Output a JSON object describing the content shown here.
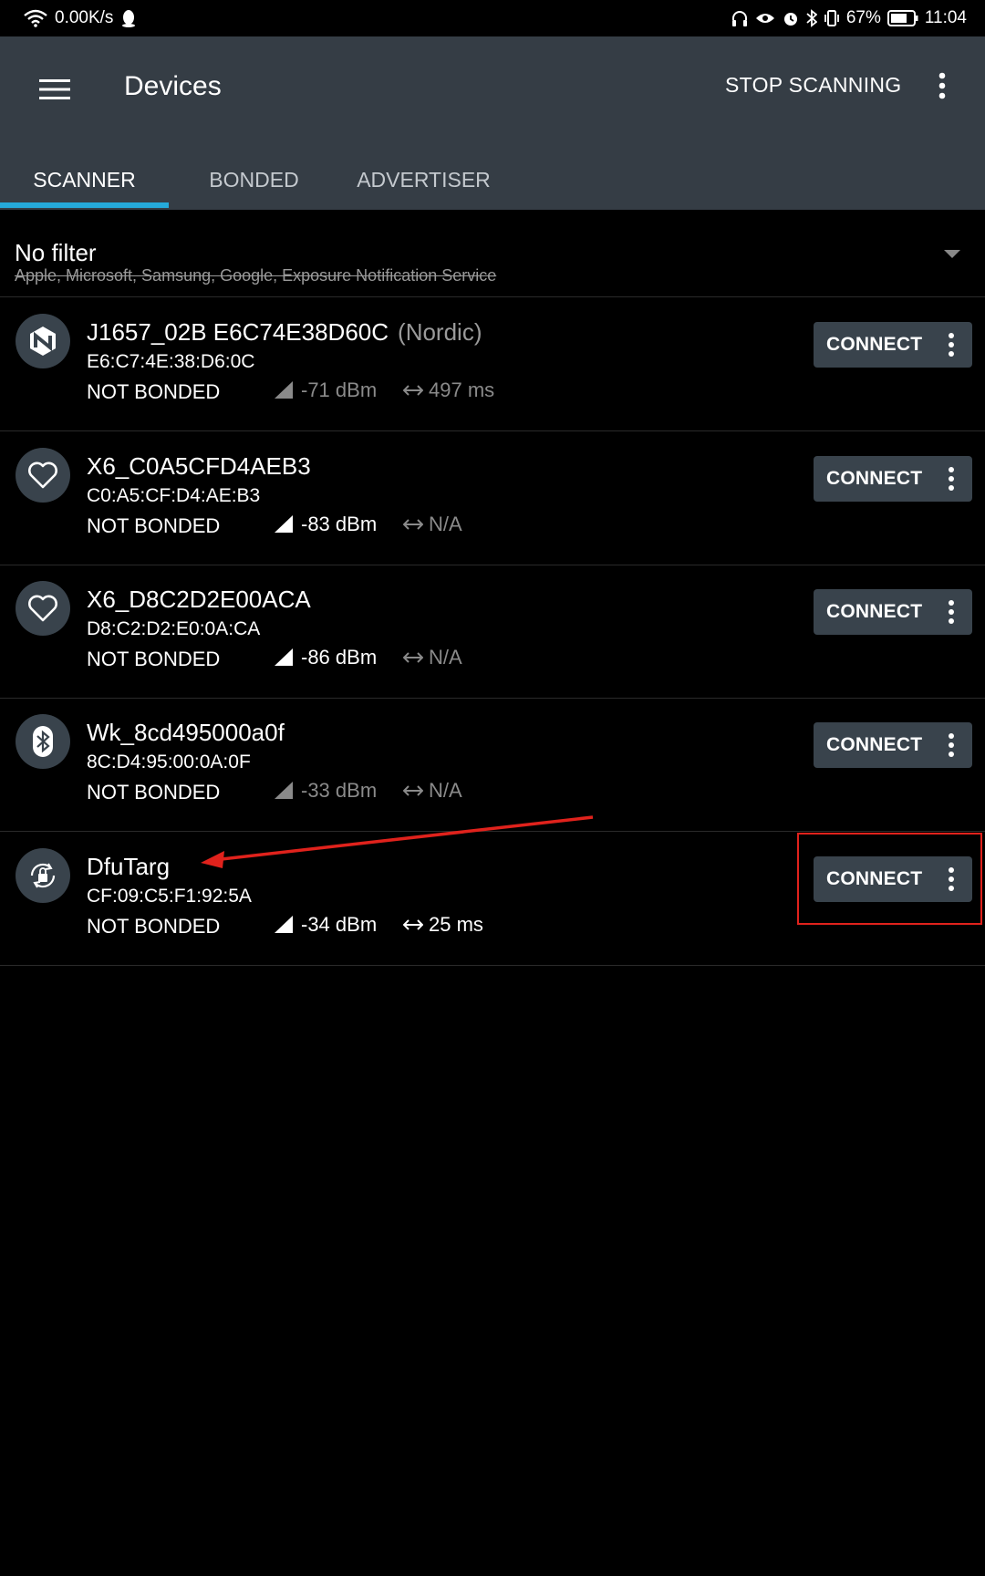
{
  "status_bar": {
    "speed": "0.00K/s",
    "battery": "67%",
    "time": "11:04"
  },
  "app_bar": {
    "title": "Devices",
    "stop_label": "STOP SCANNING"
  },
  "tabs": [
    {
      "label": "SCANNER",
      "active": true
    },
    {
      "label": "BONDED",
      "active": false
    },
    {
      "label": "ADVERTISER",
      "active": false
    }
  ],
  "filter": {
    "title": "No filter",
    "subtitle": "Apple, Microsoft, Samsung, Google, Exposure Notification Service"
  },
  "devices": [
    {
      "icon": "nordic-icon",
      "name": "J1657_02B E6C74E38D60C",
      "vendor": "(Nordic)",
      "address": "E6:C7:4E:38:D6:0C",
      "bond": "NOT BONDED",
      "rssi": "-71 dBm",
      "interval": "497 ms",
      "dimmed": true,
      "connect_label": "CONNECT"
    },
    {
      "icon": "heart-icon",
      "name": "X6_C0A5CFD4AEB3",
      "vendor": "",
      "address": "C0:A5:CF:D4:AE:B3",
      "bond": "NOT BONDED",
      "rssi": "-83 dBm",
      "interval": "N/A",
      "dimmed": false,
      "connect_label": "CONNECT"
    },
    {
      "icon": "heart-icon",
      "name": "X6_D8C2D2E00ACA",
      "vendor": "",
      "address": "D8:C2:D2:E0:0A:CA",
      "bond": "NOT BONDED",
      "rssi": "-86 dBm",
      "interval": "N/A",
      "dimmed": false,
      "connect_label": "CONNECT"
    },
    {
      "icon": "bluetooth-icon",
      "name": "Wk_8cd495000a0f",
      "vendor": "",
      "address": "8C:D4:95:00:0A:0F",
      "bond": "NOT BONDED",
      "rssi": "-33 dBm",
      "interval": "N/A",
      "dimmed": true,
      "connect_label": "CONNECT"
    },
    {
      "icon": "dfu-icon",
      "name": "DfuTarg",
      "vendor": "",
      "address": "CF:09:C5:F1:92:5A",
      "bond": "NOT BONDED",
      "rssi": "-34 dBm",
      "interval": "25 ms",
      "dimmed": false,
      "connect_label": "CONNECT"
    }
  ],
  "colors": {
    "app_bar": "#353d45",
    "tab_indicator": "#25a9d9",
    "button_bg": "#39434c",
    "annotation": "#e0221c"
  }
}
